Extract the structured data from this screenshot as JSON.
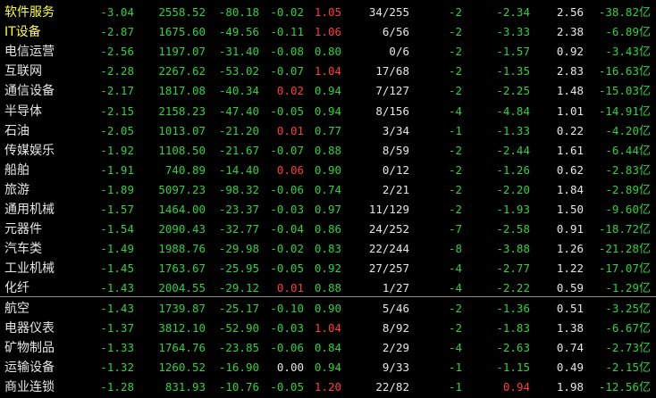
{
  "colors": {
    "background": "#000000",
    "name": "#e6e6e6",
    "name_highlight": "#ffff33",
    "down": "#2fd23c",
    "up": "#ff3b3b",
    "neutral": "#e6e6e6",
    "divider": "#8a8a8a"
  },
  "unit": "亿",
  "rows": [
    {
      "name": "软件服务",
      "highlight": true,
      "cells": [
        "-3.04",
        "2558.52",
        "-80.18",
        "-0.02",
        "1.05",
        "34/255",
        "-2",
        "-2.34",
        "2.56",
        "-38.82"
      ],
      "colors": [
        "down",
        "down",
        "down",
        "down",
        "up",
        "neutral",
        "down",
        "down",
        "neutral",
        "down"
      ]
    },
    {
      "name": "IT设备",
      "highlight": true,
      "cells": [
        "-2.87",
        "1675.60",
        "-49.56",
        "-0.11",
        "1.06",
        "6/56",
        "-2",
        "-3.33",
        "2.38",
        "-6.89"
      ],
      "colors": [
        "down",
        "down",
        "down",
        "down",
        "up",
        "neutral",
        "down",
        "down",
        "neutral",
        "down"
      ]
    },
    {
      "name": "电信运营",
      "highlight": false,
      "cells": [
        "-2.56",
        "1197.07",
        "-31.40",
        "-0.08",
        "0.80",
        "0/6",
        "-2",
        "-1.57",
        "0.92",
        "-3.43"
      ],
      "colors": [
        "down",
        "down",
        "down",
        "down",
        "down",
        "neutral",
        "down",
        "down",
        "neutral",
        "down"
      ]
    },
    {
      "name": "互联网",
      "highlight": false,
      "cells": [
        "-2.28",
        "2267.62",
        "-53.02",
        "-0.07",
        "1.04",
        "17/68",
        "-2",
        "-1.35",
        "2.83",
        "-16.63"
      ],
      "colors": [
        "down",
        "down",
        "down",
        "down",
        "up",
        "neutral",
        "down",
        "down",
        "neutral",
        "down"
      ]
    },
    {
      "name": "通信设备",
      "highlight": false,
      "cells": [
        "-2.17",
        "1817.08",
        "-40.34",
        "0.02",
        "0.94",
        "7/127",
        "-2",
        "-2.25",
        "1.48",
        "-15.03"
      ],
      "colors": [
        "down",
        "down",
        "down",
        "up",
        "down",
        "neutral",
        "down",
        "down",
        "neutral",
        "down"
      ]
    },
    {
      "name": "半导体",
      "highlight": false,
      "cells": [
        "-2.15",
        "2158.23",
        "-47.40",
        "-0.05",
        "0.94",
        "8/156",
        "-4",
        "-4.84",
        "1.01",
        "-14.91"
      ],
      "colors": [
        "down",
        "down",
        "down",
        "down",
        "down",
        "neutral",
        "down",
        "down",
        "neutral",
        "down"
      ]
    },
    {
      "name": "石油",
      "highlight": false,
      "cells": [
        "-2.05",
        "1013.07",
        "-21.20",
        "0.01",
        "0.77",
        "3/34",
        "-1",
        "-1.33",
        "0.22",
        "-4.20"
      ],
      "colors": [
        "down",
        "down",
        "down",
        "up",
        "down",
        "neutral",
        "down",
        "down",
        "neutral",
        "down"
      ]
    },
    {
      "name": "传媒娱乐",
      "highlight": false,
      "cells": [
        "-1.92",
        "1108.50",
        "-21.67",
        "-0.07",
        "0.88",
        "8/59",
        "-2",
        "-2.44",
        "1.61",
        "-6.44"
      ],
      "colors": [
        "down",
        "down",
        "down",
        "down",
        "down",
        "neutral",
        "down",
        "down",
        "neutral",
        "down"
      ]
    },
    {
      "name": "船舶",
      "highlight": false,
      "cells": [
        "-1.91",
        "740.89",
        "-14.40",
        "0.06",
        "0.90",
        "0/12",
        "-2",
        "-1.26",
        "0.62",
        "-2.83"
      ],
      "colors": [
        "down",
        "down",
        "down",
        "up",
        "down",
        "neutral",
        "down",
        "down",
        "neutral",
        "down"
      ]
    },
    {
      "name": "旅游",
      "highlight": false,
      "cells": [
        "-1.89",
        "5097.23",
        "-98.32",
        "-0.06",
        "0.74",
        "2/21",
        "-2",
        "-2.20",
        "1.84",
        "-2.89"
      ],
      "colors": [
        "down",
        "down",
        "down",
        "down",
        "down",
        "neutral",
        "down",
        "down",
        "neutral",
        "down"
      ]
    },
    {
      "name": "通用机械",
      "highlight": false,
      "cells": [
        "-1.57",
        "1464.00",
        "-23.37",
        "-0.03",
        "0.97",
        "11/129",
        "-2",
        "-1.93",
        "1.50",
        "-9.60"
      ],
      "colors": [
        "down",
        "down",
        "down",
        "down",
        "down",
        "neutral",
        "down",
        "down",
        "neutral",
        "down"
      ]
    },
    {
      "name": "元器件",
      "highlight": false,
      "cells": [
        "-1.54",
        "2090.43",
        "-32.77",
        "-0.04",
        "0.86",
        "24/252",
        "-7",
        "-2.58",
        "0.91",
        "-18.72"
      ],
      "colors": [
        "down",
        "down",
        "down",
        "down",
        "down",
        "neutral",
        "down",
        "down",
        "neutral",
        "down"
      ]
    },
    {
      "name": "汽车类",
      "highlight": false,
      "cells": [
        "-1.49",
        "1988.76",
        "-29.98",
        "-0.02",
        "0.83",
        "22/244",
        "-8",
        "-3.88",
        "1.26",
        "-21.28"
      ],
      "colors": [
        "down",
        "down",
        "down",
        "down",
        "down",
        "neutral",
        "down",
        "down",
        "neutral",
        "down"
      ]
    },
    {
      "name": "工业机械",
      "highlight": false,
      "cells": [
        "-1.45",
        "1763.67",
        "-25.95",
        "-0.05",
        "0.92",
        "27/257",
        "-4",
        "-2.77",
        "1.22",
        "-17.07"
      ],
      "colors": [
        "down",
        "down",
        "down",
        "down",
        "down",
        "neutral",
        "down",
        "down",
        "neutral",
        "down"
      ]
    },
    {
      "name": "化纤",
      "highlight": false,
      "cells": [
        "-1.43",
        "2004.55",
        "-29.12",
        "0.01",
        "0.88",
        "1/27",
        "-4",
        "-2.22",
        "0.59",
        "-1.29"
      ],
      "colors": [
        "down",
        "down",
        "down",
        "up",
        "down",
        "neutral",
        "down",
        "down",
        "neutral",
        "down"
      ]
    },
    {
      "name": "航空",
      "highlight": false,
      "cells": [
        "-1.43",
        "1739.87",
        "-25.17",
        "-0.10",
        "0.90",
        "5/46",
        "-2",
        "-1.36",
        "0.51",
        "-3.25"
      ],
      "colors": [
        "down",
        "down",
        "down",
        "down",
        "down",
        "neutral",
        "down",
        "down",
        "neutral",
        "down"
      ]
    },
    {
      "name": "电器仪表",
      "highlight": false,
      "cells": [
        "-1.37",
        "3812.10",
        "-52.90",
        "-0.03",
        "1.04",
        "8/92",
        "-2",
        "-1.83",
        "1.38",
        "-6.67"
      ],
      "colors": [
        "down",
        "down",
        "down",
        "down",
        "up",
        "neutral",
        "down",
        "down",
        "neutral",
        "down"
      ]
    },
    {
      "name": "矿物制品",
      "highlight": false,
      "cells": [
        "-1.33",
        "1764.76",
        "-23.85",
        "-0.06",
        "0.84",
        "2/29",
        "-4",
        "-2.63",
        "0.74",
        "-2.73"
      ],
      "colors": [
        "down",
        "down",
        "down",
        "down",
        "down",
        "neutral",
        "down",
        "down",
        "neutral",
        "down"
      ]
    },
    {
      "name": "运输设备",
      "highlight": false,
      "cells": [
        "-1.32",
        "1260.52",
        "-16.90",
        "0.00",
        "0.94",
        "9/33",
        "-1",
        "-1.15",
        "0.49",
        "-2.15"
      ],
      "colors": [
        "down",
        "down",
        "down",
        "neutral",
        "down",
        "neutral",
        "down",
        "down",
        "neutral",
        "down"
      ]
    },
    {
      "name": "商业连锁",
      "highlight": false,
      "cells": [
        "-1.28",
        "831.93",
        "-10.76",
        "-0.05",
        "1.20",
        "22/82",
        "-1",
        "0.94",
        "1.98",
        "-12.56"
      ],
      "colors": [
        "down",
        "down",
        "down",
        "down",
        "up",
        "neutral",
        "down",
        "up",
        "neutral",
        "down"
      ]
    }
  ]
}
